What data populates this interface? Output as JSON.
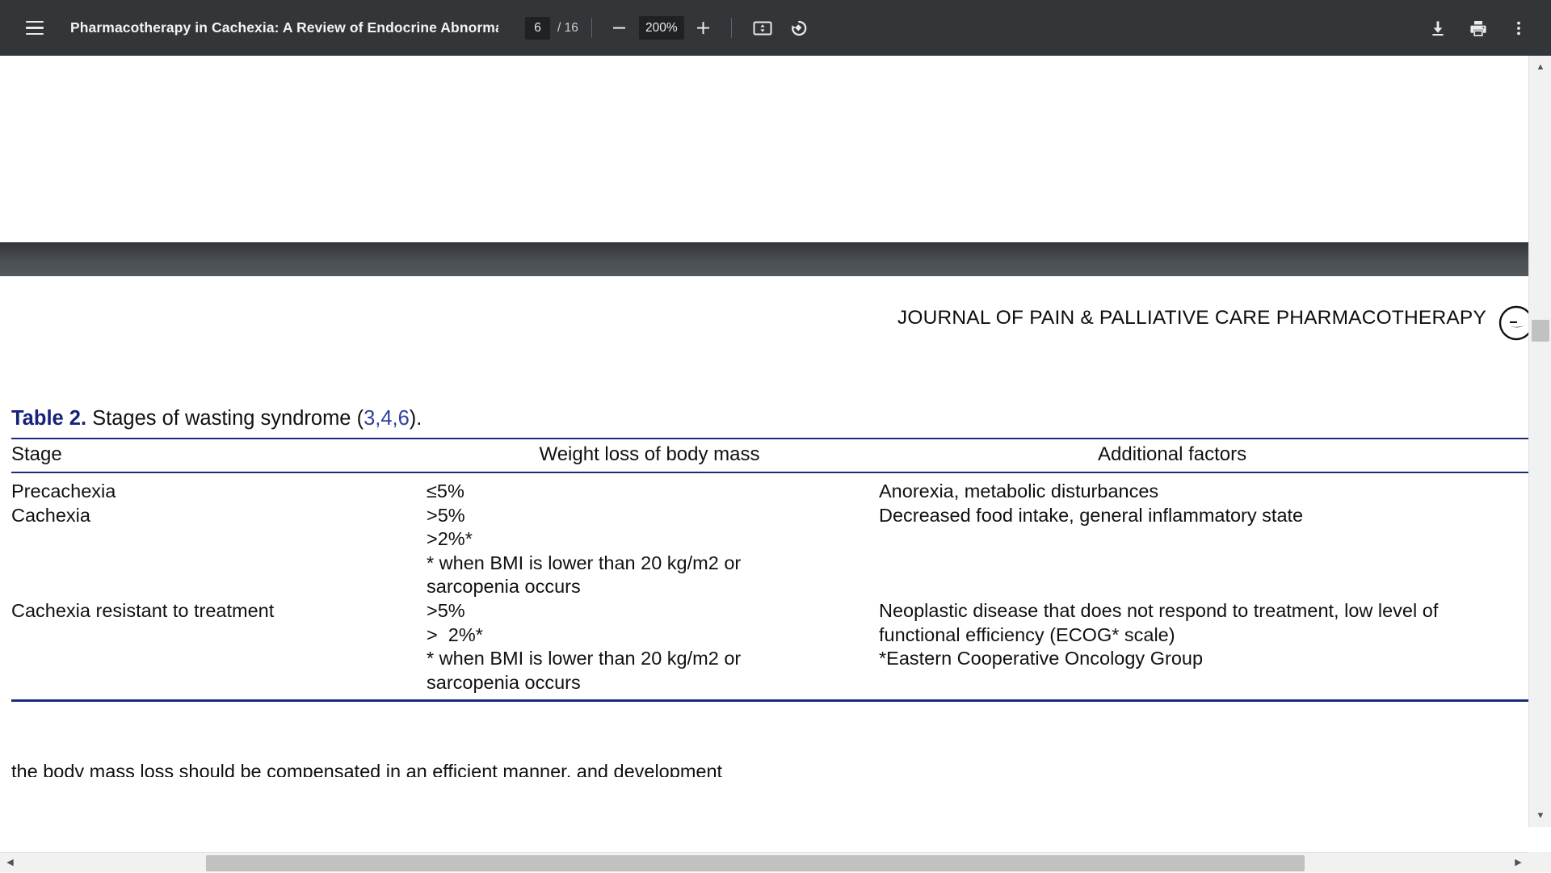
{
  "toolbar": {
    "menu_icon": "hamburger-menu-icon",
    "document_title": "Pharmacotherapy in Cachexia: A Review of Endocrine Abnorma…",
    "page_number": "6",
    "page_count": "/ 16",
    "zoom_out_label": "−",
    "zoom_level": "200%",
    "zoom_in_label": "+",
    "fit_page_icon": "fit-to-page-icon",
    "rotate_icon": "rotate-clockwise-icon",
    "download_icon": "download-icon",
    "print_icon": "print-icon",
    "more_icon": "more-options-icon",
    "accent_bg": "#323639",
    "field_bg": "#202124",
    "text_color": "#e8eaed"
  },
  "document": {
    "journal_header": "JOURNAL OF PAIN & PALLIATIVE CARE PHARMACOTHERAPY",
    "logo_name": "journal-crossmark-logo",
    "table": {
      "caption_label": "Table 2.",
      "caption_text": "Stages of wasting syndrome (",
      "caption_citation": "3,4,6",
      "caption_suffix": ").",
      "rule_color": "#1b2a7a",
      "label_color": "#17237a",
      "columns": [
        "Stage",
        "Weight loss of body mass",
        "Additional factors"
      ],
      "rows": [
        {
          "stage": "Precachexia",
          "weight": [
            "≤5%"
          ],
          "extra": [
            "Anorexia, metabolic disturbances"
          ]
        },
        {
          "stage": "Cachexia",
          "weight": [
            ">5%",
            ">2%*",
            "* when BMI is lower than 20 kg/m2 or",
            "sarcopenia occurs"
          ],
          "extra": [
            "Decreased food intake, general inflammatory state"
          ]
        },
        {
          "stage": "Cachexia resistant to treatment",
          "weight": [
            ">5%",
            ">  2%*",
            "* when BMI is lower than 20 kg/m2 or",
            "sarcopenia occurs"
          ],
          "extra": [
            "Neoplastic disease that does not respond to treatment, low level of",
            "functional efficiency (ECOG* scale)",
            "*Eastern Cooperative Oncology Group"
          ]
        }
      ]
    },
    "below_table_partial": "the body mass loss should be compensated in an efficient manner, and development"
  },
  "scrollbars": {
    "vertical_up_glyph": "▲",
    "vertical_down_glyph": "▼",
    "horizontal_left_glyph": "◀",
    "horizontal_right_glyph": "▶",
    "thumb_color": "#c1c1c1"
  }
}
